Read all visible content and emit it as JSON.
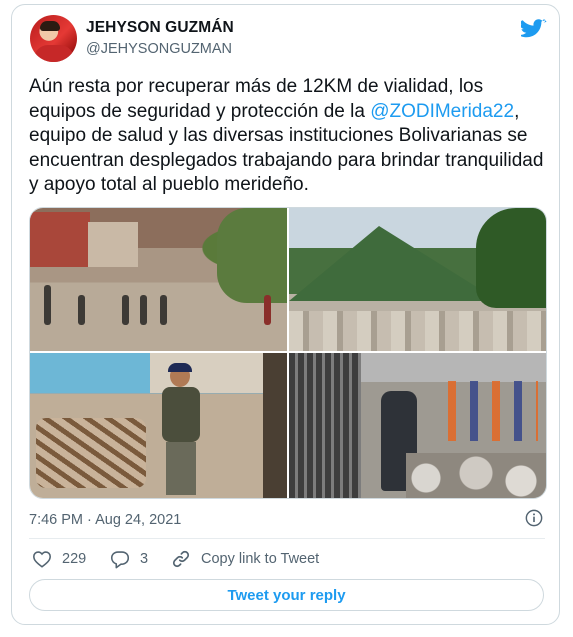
{
  "author": {
    "name": "JEHYSON GUZMÁN",
    "handle": "@JEHYSONGUZMAN"
  },
  "tweet": {
    "text_before": "Aún resta por recuperar más de 12KM de vialidad, los equipos de seguridad y protección de la ",
    "mention": "@ZODIMerida22",
    "text_after": ", equipo de salud y las diversas instituciones Bolivarianas se encuentran desplegados trabajando para brindar tranquilidad y apoyo total al pueblo merideño.",
    "timestamp": "7:46 PM · Aug 24, 2021"
  },
  "actions": {
    "likes": "229",
    "replies": "3",
    "copy_link": "Copy link to Tweet"
  },
  "reply_button": "Tweet your reply",
  "icons": [
    "avatar",
    "twitter-bird-icon",
    "info-icon",
    "heart-icon",
    "reply-bubble-icon",
    "link-icon"
  ],
  "colors": {
    "accent": "#1d9bf0",
    "text": "#0f1419",
    "muted": "#536471",
    "border": "#cfd9de"
  }
}
